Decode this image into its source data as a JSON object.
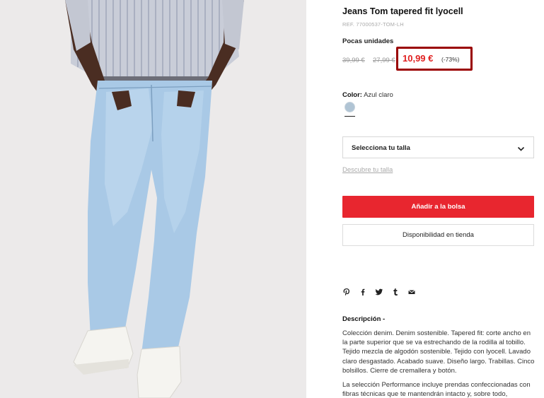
{
  "product": {
    "title": "Jeans Tom tapered fit lyocell",
    "ref": "REF. 77000537-TOM-LH",
    "stock_note": "Pocas unidades",
    "original_price": "39,99 €",
    "previous_price": "27,99 €",
    "sale_price": "10,99 €",
    "discount": "(-73%)",
    "color_label": "Color:",
    "color_value": "Azul claro",
    "swatch_color": "#b0c4d4"
  },
  "size": {
    "select_label": "Selecciona tu talla",
    "guide_link": "Descubre tu talla"
  },
  "actions": {
    "add_to_bag": "Añadir a la bolsa",
    "store_availability": "Disponibilidad en tienda"
  },
  "share_icons": [
    "pinterest-icon",
    "facebook-icon",
    "twitter-icon",
    "tumblr-icon",
    "email-icon"
  ],
  "description": {
    "title": "Descripción -",
    "paragraph1": "Colección denim. Denim sostenible. Tapered fit: corte ancho en la parte superior que se va estrechando de la rodilla al tobillo. Tejido mezcla de algodón sostenible. Tejido con lyocell. Lavado claro desgastado. Acabado suave. Diseño largo. Trabillas. Cinco bolsillos. Cierre de cremallera y botón.",
    "paragraph2": "La selección Performance incluye prendas confeccionadas con fibras técnicas que te mantendrán intacto y, sobre todo,"
  },
  "colors": {
    "accent_red": "#e8262f",
    "sale_red": "#e02020",
    "highlight_border": "#9a0000"
  }
}
